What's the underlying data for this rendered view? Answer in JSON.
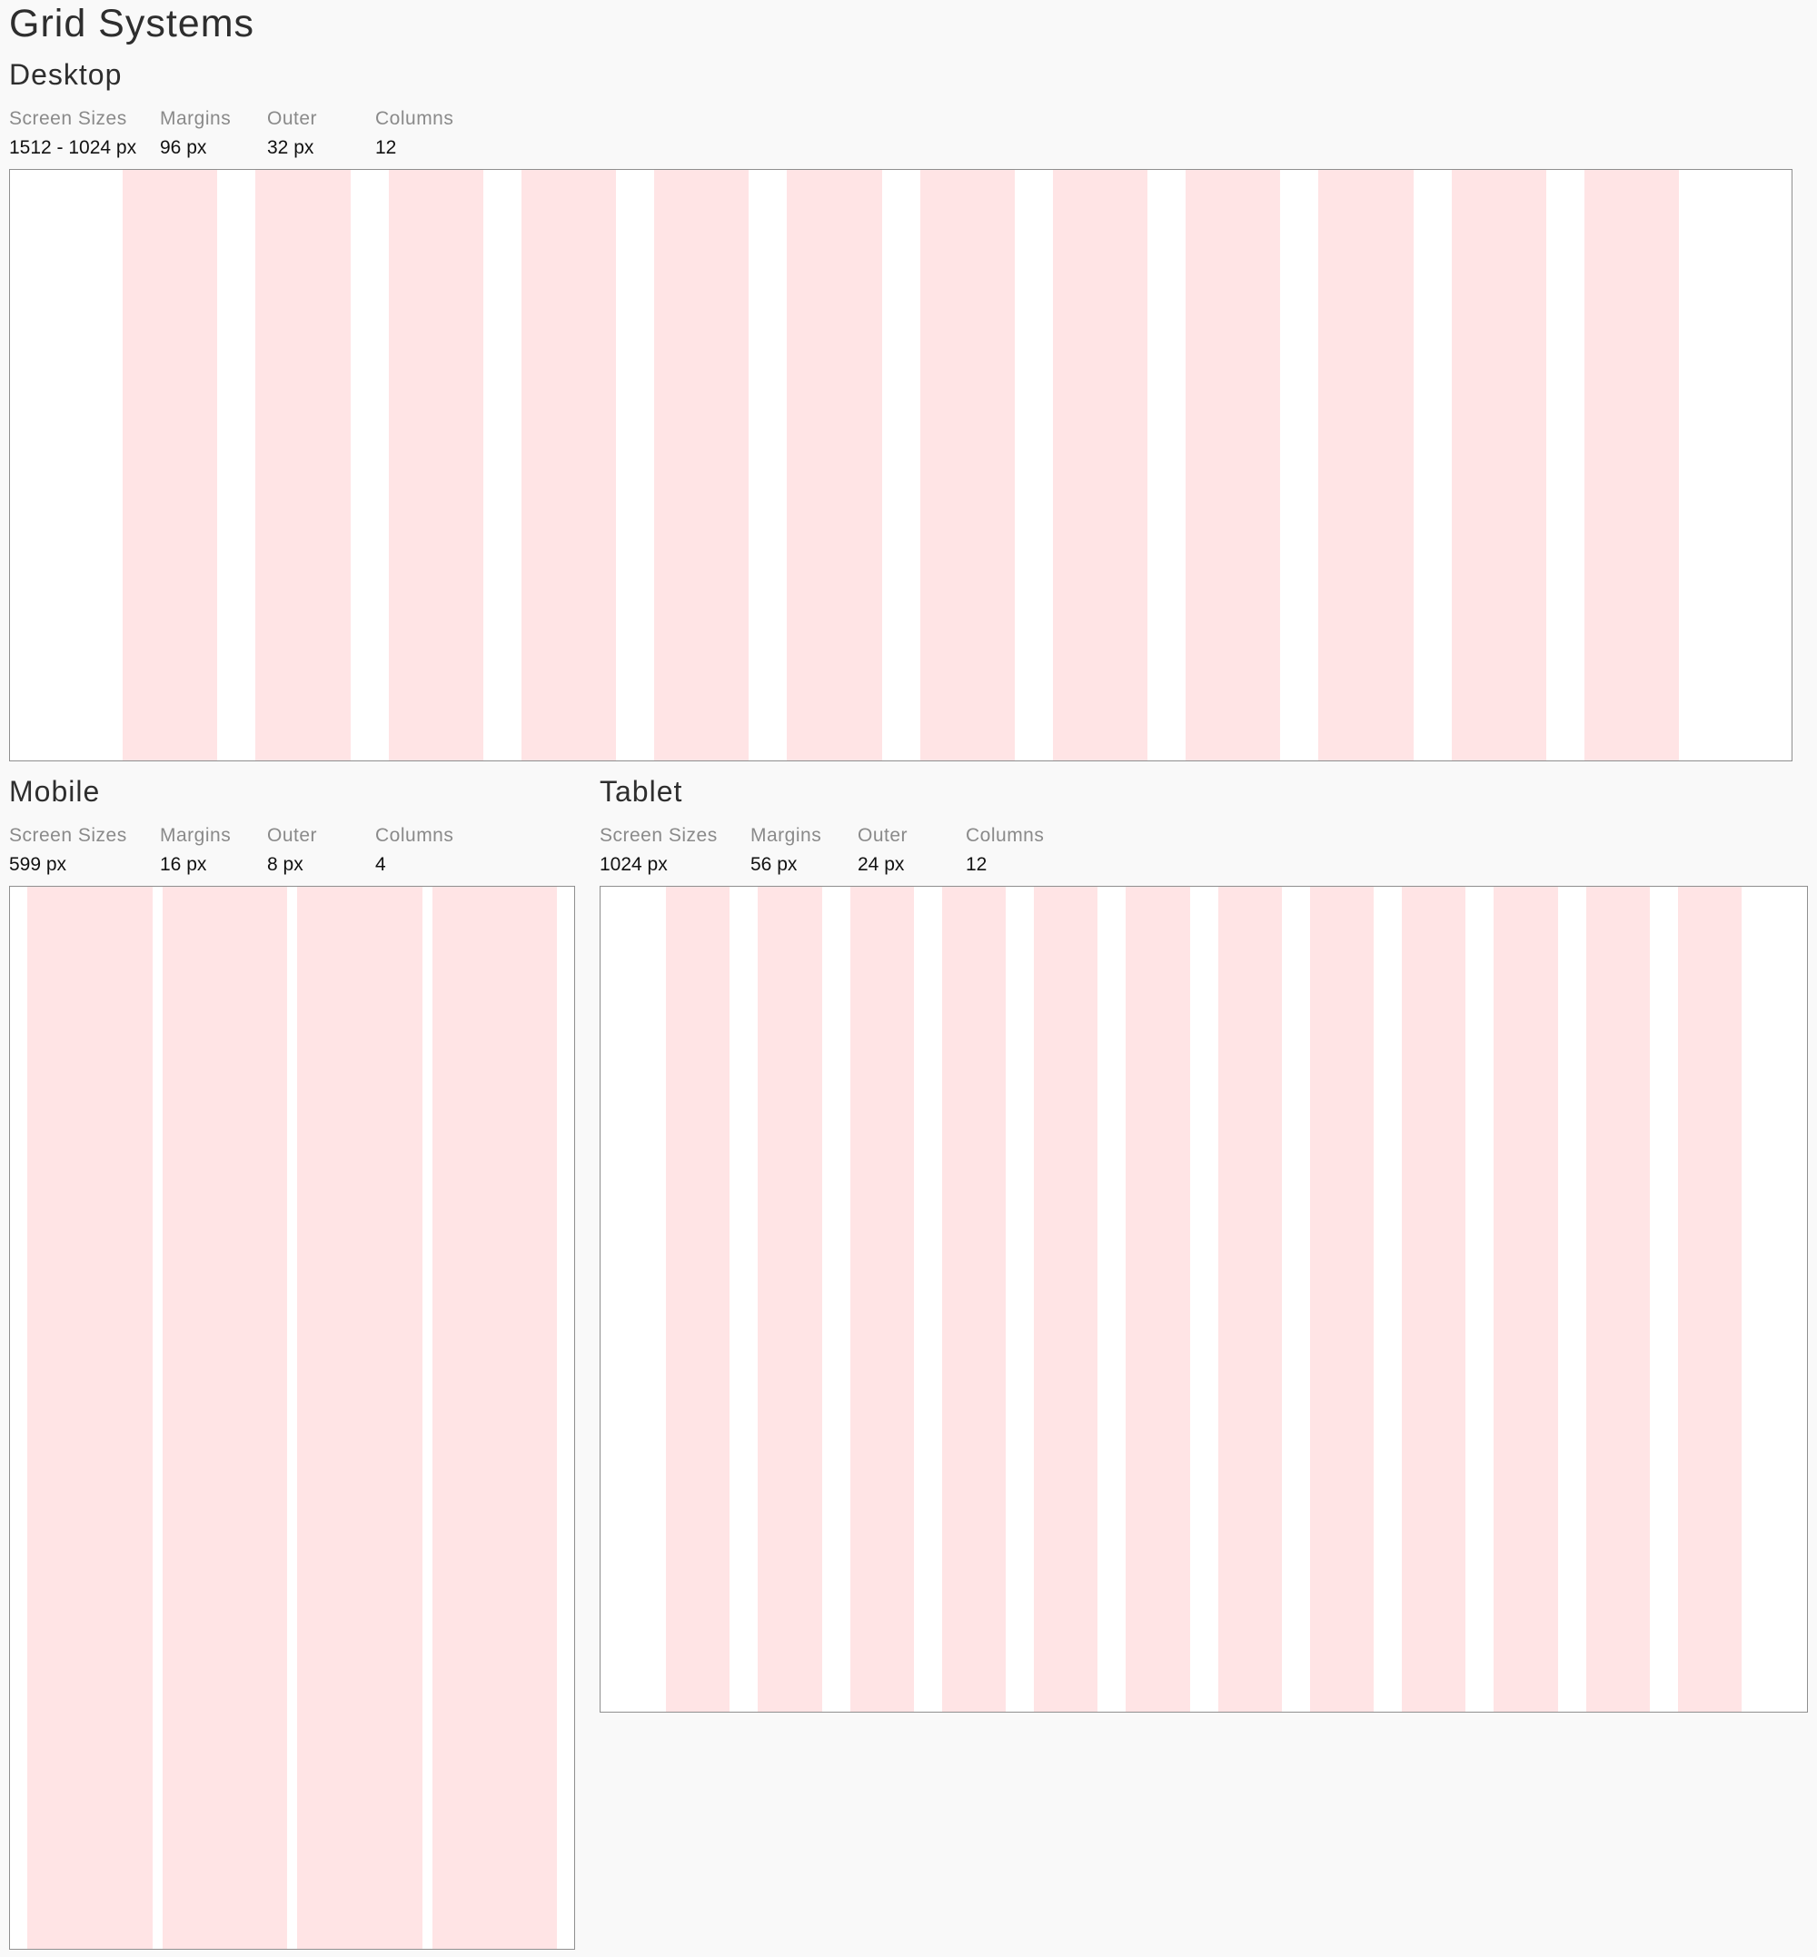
{
  "title": "Grid Systems",
  "column_color": "#ffe4e5",
  "spec_labels": {
    "screen_sizes": "Screen Sizes",
    "margins": "Margins",
    "outer": "Outer",
    "columns": "Columns"
  },
  "desktop": {
    "name": "Desktop",
    "screen_sizes": "1512 - 1024 px",
    "margins": "96 px",
    "outer": "32 px",
    "columns": "12",
    "column_count": 12
  },
  "mobile": {
    "name": "Mobile",
    "screen_sizes": "599 px",
    "margins": "16 px",
    "outer": "8 px",
    "columns": "4",
    "column_count": 4
  },
  "tablet": {
    "name": "Tablet",
    "screen_sizes": "1024 px",
    "margins": "56 px",
    "outer": "24 px",
    "columns": "12",
    "column_count": 12
  }
}
